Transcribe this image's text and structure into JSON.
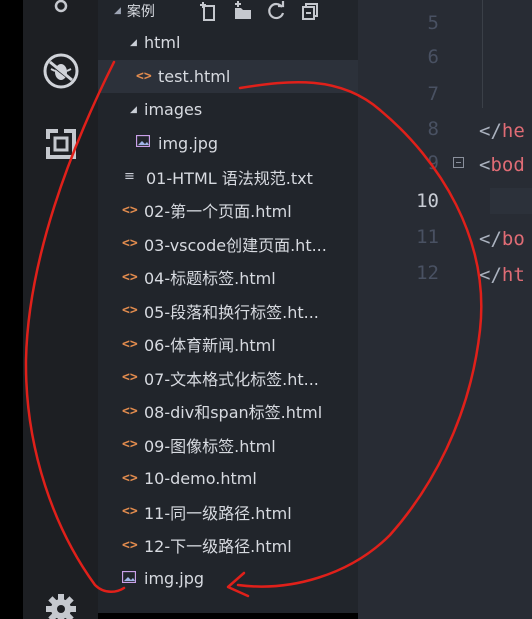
{
  "sidebar": {
    "folder_name": "案例",
    "items": [
      {
        "label": "html",
        "kind": "folder",
        "depth": 1
      },
      {
        "label": "test.html",
        "kind": "html",
        "depth": 2
      },
      {
        "label": "images",
        "kind": "folder",
        "depth": 1
      },
      {
        "label": "img.jpg",
        "kind": "image",
        "depth": 2
      },
      {
        "label": "01-HTML 语法规范.txt",
        "kind": "txt",
        "depth": 1
      },
      {
        "label": "02-第一个页面.html",
        "kind": "html",
        "depth": 1
      },
      {
        "label": "03-vscode创建页面.ht...",
        "kind": "html",
        "depth": 1
      },
      {
        "label": "04-标题标签.html",
        "kind": "html",
        "depth": 1
      },
      {
        "label": "05-段落和换行标签.ht...",
        "kind": "html",
        "depth": 1
      },
      {
        "label": "06-体育新闻.html",
        "kind": "html",
        "depth": 1
      },
      {
        "label": "07-文本格式化标签.ht...",
        "kind": "html",
        "depth": 1
      },
      {
        "label": "08-div和span标签.html",
        "kind": "html",
        "depth": 1
      },
      {
        "label": "09-图像标签.html",
        "kind": "html",
        "depth": 1
      },
      {
        "label": "10-demo.html",
        "kind": "html",
        "depth": 1
      },
      {
        "label": "11-同一级路径.html",
        "kind": "html",
        "depth": 1
      },
      {
        "label": "12-下一级路径.html",
        "kind": "html",
        "depth": 1
      },
      {
        "label": "img.jpg",
        "kind": "image",
        "depth": 1
      }
    ]
  },
  "editor": {
    "line_numbers": [
      "5",
      "6",
      "7",
      "8",
      "9",
      "10",
      "11",
      "12"
    ],
    "current_line": "10",
    "code_lines": [
      {
        "punc": "</",
        "tag": "he"
      },
      {
        "punc": "<",
        "tag": "bod"
      },
      {
        "punc": "</",
        "tag": "bo"
      },
      {
        "punc": "</",
        "tag": "ht"
      }
    ]
  },
  "icons": {
    "activity": [
      "source-control-icon",
      "no-debug-icon",
      "extensions-icon",
      "settings-gear-icon"
    ],
    "header_actions": [
      "new-file-icon",
      "new-folder-icon",
      "refresh-icon",
      "collapse-all-icon"
    ]
  },
  "colors": {
    "html_icon": "#e38c4e",
    "annotation": "#e0201a",
    "tag": "#e06c75"
  }
}
